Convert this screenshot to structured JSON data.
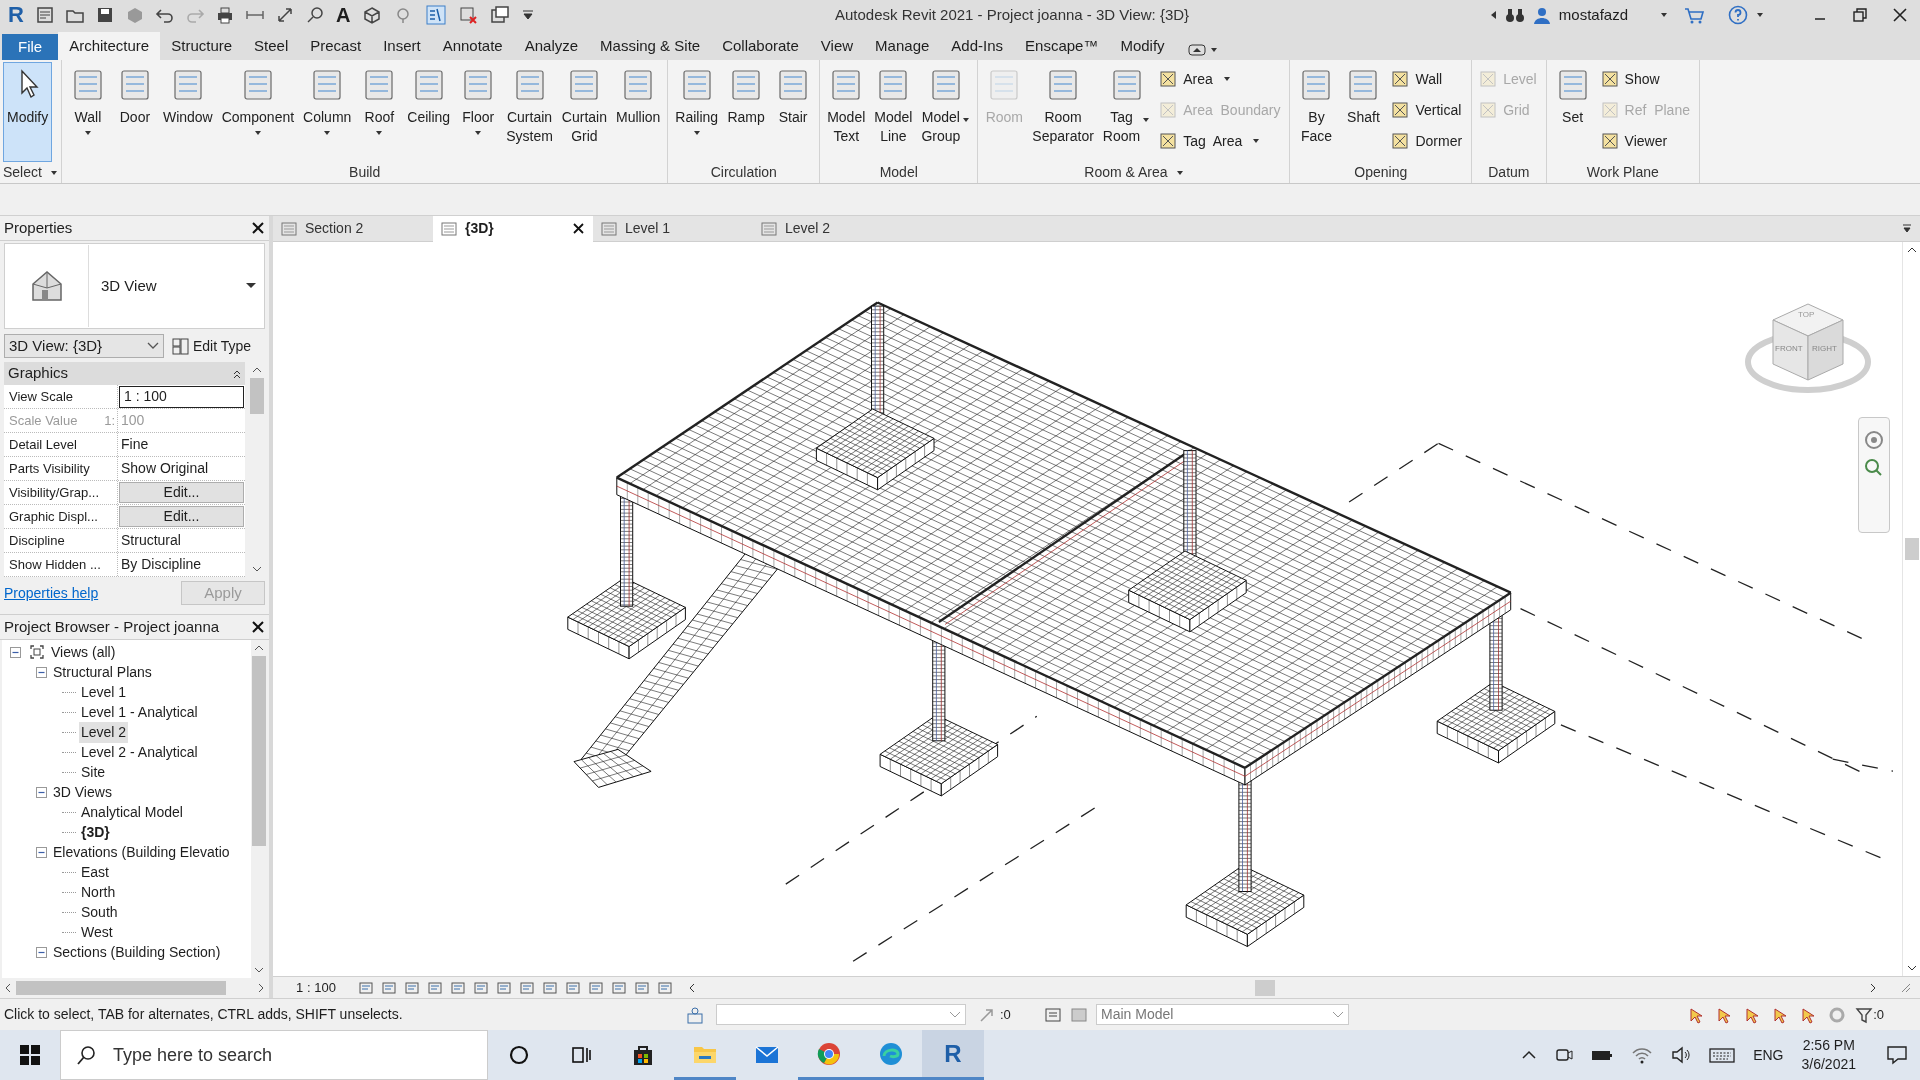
{
  "window": {
    "logo_letter": "R",
    "text_tool_glyph": "A",
    "title": "Autodesk Revit 2021 - Project joanna - 3D View: {3D}",
    "user": "mostafazd"
  },
  "ribbon_tabs": [
    {
      "label": "File",
      "kind": "application",
      "selected": false
    },
    {
      "label": "Architecture",
      "kind": "tab",
      "selected": true
    },
    {
      "label": "Structure",
      "kind": "tab",
      "selected": false
    },
    {
      "label": "Steel",
      "kind": "tab",
      "selected": false
    },
    {
      "label": "Precast",
      "kind": "tab",
      "selected": false
    },
    {
      "label": "Insert",
      "kind": "tab",
      "selected": false
    },
    {
      "label": "Annotate",
      "kind": "tab",
      "selected": false
    },
    {
      "label": "Analyze",
      "kind": "tab",
      "selected": false
    },
    {
      "label": "Massing & Site",
      "kind": "tab",
      "selected": false
    },
    {
      "label": "Collaborate",
      "kind": "tab",
      "selected": false
    },
    {
      "label": "View",
      "kind": "tab",
      "selected": false
    },
    {
      "label": "Manage",
      "kind": "tab",
      "selected": false
    },
    {
      "label": "Add-Ins",
      "kind": "tab",
      "selected": false
    },
    {
      "label": "Enscape™",
      "kind": "tab",
      "selected": false
    },
    {
      "label": "Modify",
      "kind": "tab",
      "selected": false
    }
  ],
  "ribbon_panels": [
    {
      "title": "Select",
      "menu": true,
      "tools": [
        {
          "label": "Modify",
          "kind": "large",
          "selected": true,
          "disabled": false
        }
      ]
    },
    {
      "title": "Build",
      "menu": false,
      "tools": [
        {
          "label": "Wall",
          "kind": "large",
          "selected": false,
          "disabled": false,
          "dropdown": true
        },
        {
          "label": "Door",
          "kind": "large",
          "selected": false,
          "disabled": false
        },
        {
          "label": "Window",
          "kind": "large",
          "selected": false,
          "disabled": false
        },
        {
          "label": "Component",
          "kind": "large",
          "selected": false,
          "disabled": false,
          "dropdown": true
        },
        {
          "label": "Column",
          "kind": "large",
          "selected": false,
          "disabled": false,
          "dropdown": true
        },
        {
          "label": "Roof",
          "kind": "large",
          "selected": false,
          "disabled": false,
          "dropdown": true
        },
        {
          "label": "Ceiling",
          "kind": "large",
          "selected": false,
          "disabled": false
        },
        {
          "label": "Floor",
          "kind": "large",
          "selected": false,
          "disabled": false,
          "dropdown": true
        },
        {
          "label": "Curtain System",
          "kind": "large",
          "selected": false,
          "disabled": false
        },
        {
          "label": "Curtain Grid",
          "kind": "large",
          "selected": false,
          "disabled": false
        },
        {
          "label": "Mullion",
          "kind": "large",
          "selected": false,
          "disabled": false
        }
      ]
    },
    {
      "title": "Circulation",
      "menu": false,
      "tools": [
        {
          "label": "Railing",
          "kind": "large",
          "selected": false,
          "disabled": false,
          "dropdown": true
        },
        {
          "label": "Ramp",
          "kind": "large",
          "selected": false,
          "disabled": false
        },
        {
          "label": "Stair",
          "kind": "large",
          "selected": false,
          "disabled": false
        }
      ]
    },
    {
      "title": "Model",
      "menu": false,
      "tools": [
        {
          "label": "Model Text",
          "kind": "large",
          "selected": false,
          "disabled": false
        },
        {
          "label": "Model Line",
          "kind": "large",
          "selected": false,
          "disabled": false
        },
        {
          "label": "Model Group",
          "kind": "large",
          "selected": false,
          "disabled": false,
          "dropdown": true,
          "caret_beside": true
        }
      ]
    },
    {
      "title": "Room & Area",
      "menu": true,
      "tools": [
        {
          "label": "Room",
          "kind": "large",
          "selected": false,
          "disabled": true
        },
        {
          "label": "Room Separator",
          "kind": "large",
          "selected": false,
          "disabled": false
        },
        {
          "label": "Tag Room",
          "kind": "large",
          "selected": false,
          "disabled": false,
          "dropdown": true,
          "caret_beside": true
        },
        {
          "kind": "stack",
          "items": [
            {
              "label": "Area",
              "disabled": false,
              "dropdown": true
            },
            {
              "label": "Area  Boundary",
              "disabled": true
            },
            {
              "label": "Tag  Area",
              "disabled": false,
              "dropdown": true
            }
          ]
        }
      ]
    },
    {
      "title": "Opening",
      "menu": false,
      "tools": [
        {
          "label": "By Face",
          "kind": "large",
          "selected": false,
          "disabled": false
        },
        {
          "label": "Shaft",
          "kind": "large",
          "selected": false,
          "disabled": false
        },
        {
          "kind": "stack",
          "items": [
            {
              "label": "Wall",
              "disabled": false
            },
            {
              "label": "Vertical",
              "disabled": false
            },
            {
              "label": "Dormer",
              "disabled": false
            }
          ]
        }
      ]
    },
    {
      "title": "Datum",
      "menu": false,
      "tools": [
        {
          "kind": "stack",
          "items": [
            {
              "label": "Level",
              "disabled": true
            },
            {
              "label": "Grid",
              "disabled": true
            }
          ]
        }
      ]
    },
    {
      "title": "Work Plane",
      "menu": false,
      "tools": [
        {
          "label": "Set",
          "kind": "large",
          "selected": false,
          "disabled": false
        },
        {
          "kind": "stack",
          "items": [
            {
              "label": "Show",
              "disabled": false
            },
            {
              "label": "Ref  Plane",
              "disabled": true
            },
            {
              "label": "Viewer",
              "disabled": false
            }
          ]
        }
      ]
    }
  ],
  "properties": {
    "title": "Properties",
    "type_name": "3D View",
    "instance": "3D View: {3D}",
    "edit_type": "Edit Type",
    "group": "Graphics",
    "rows": [
      {
        "name": "View Scale",
        "value": "1 : 100",
        "kind": "input",
        "disabled": false
      },
      {
        "name": "Scale Value",
        "prefix": "1:",
        "value": "100",
        "kind": "text",
        "disabled": true
      },
      {
        "name": "Detail Level",
        "value": "Fine",
        "kind": "text",
        "disabled": false
      },
      {
        "name": "Parts Visibility",
        "value": "Show Original",
        "kind": "text",
        "disabled": false
      },
      {
        "name": "Visibility/Grap...",
        "value": "Edit...",
        "kind": "button",
        "disabled": false
      },
      {
        "name": "Graphic Displ...",
        "value": "Edit...",
        "kind": "button",
        "disabled": false
      },
      {
        "name": "Discipline",
        "value": "Structural",
        "kind": "text",
        "disabled": false
      },
      {
        "name": "Show Hidden ...",
        "value": "By Discipline",
        "kind": "text",
        "disabled": false
      }
    ],
    "help_link": "Properties help",
    "apply": "Apply",
    "apply_disabled": true
  },
  "project_browser": {
    "title": "Project Browser - Project joanna",
    "tree": [
      {
        "label": "Views (all)",
        "expanded": true,
        "selected": false,
        "current": false,
        "children": [
          {
            "label": "Structural Plans",
            "expanded": true,
            "selected": false,
            "current": false,
            "children": [
              {
                "label": "Level 1",
                "selected": false,
                "current": false
              },
              {
                "label": "Level 1 - Analytical",
                "selected": false,
                "current": false
              },
              {
                "label": "Level 2",
                "selected": true,
                "current": false
              },
              {
                "label": "Level 2 - Analytical",
                "selected": false,
                "current": false
              },
              {
                "label": "Site",
                "selected": false,
                "current": false
              }
            ]
          },
          {
            "label": "3D Views",
            "expanded": true,
            "selected": false,
            "current": false,
            "children": [
              {
                "label": "Analytical Model",
                "selected": false,
                "current": false
              },
              {
                "label": "{3D}",
                "selected": false,
                "current": true
              }
            ]
          },
          {
            "label": "Elevations (Building Elevatio",
            "expanded": true,
            "selected": false,
            "current": false,
            "children": [
              {
                "label": "East",
                "selected": false,
                "current": false
              },
              {
                "label": "North",
                "selected": false,
                "current": false
              },
              {
                "label": "South",
                "selected": false,
                "current": false
              },
              {
                "label": "West",
                "selected": false,
                "current": false
              }
            ]
          },
          {
            "label": "Sections (Building Section)",
            "expanded": true,
            "selected": false,
            "current": false
          }
        ]
      }
    ]
  },
  "view_tabs": [
    {
      "label": "Section 2",
      "selected": false,
      "closable": false
    },
    {
      "label": "{3D}",
      "selected": true,
      "closable": true
    },
    {
      "label": "Level 1",
      "selected": false,
      "closable": false
    },
    {
      "label": "Level 2",
      "selected": false,
      "closable": false
    }
  ],
  "view_cube": {
    "faces": [
      "TOP",
      "FRONT",
      "RIGHT"
    ]
  },
  "view_control_bar": {
    "scale": "1 : 100"
  },
  "status_bar": {
    "message": "Click to select, TAB for alternates, CTRL adds, SHIFT unselects.",
    "design_option_count": ":0",
    "workset": "Main Model",
    "filter_count": ":0"
  },
  "taskbar": {
    "search_placeholder": "Type here to search",
    "revit_letter": "R",
    "language": "ENG",
    "time": "2:56 PM",
    "date": "3/6/2021"
  }
}
